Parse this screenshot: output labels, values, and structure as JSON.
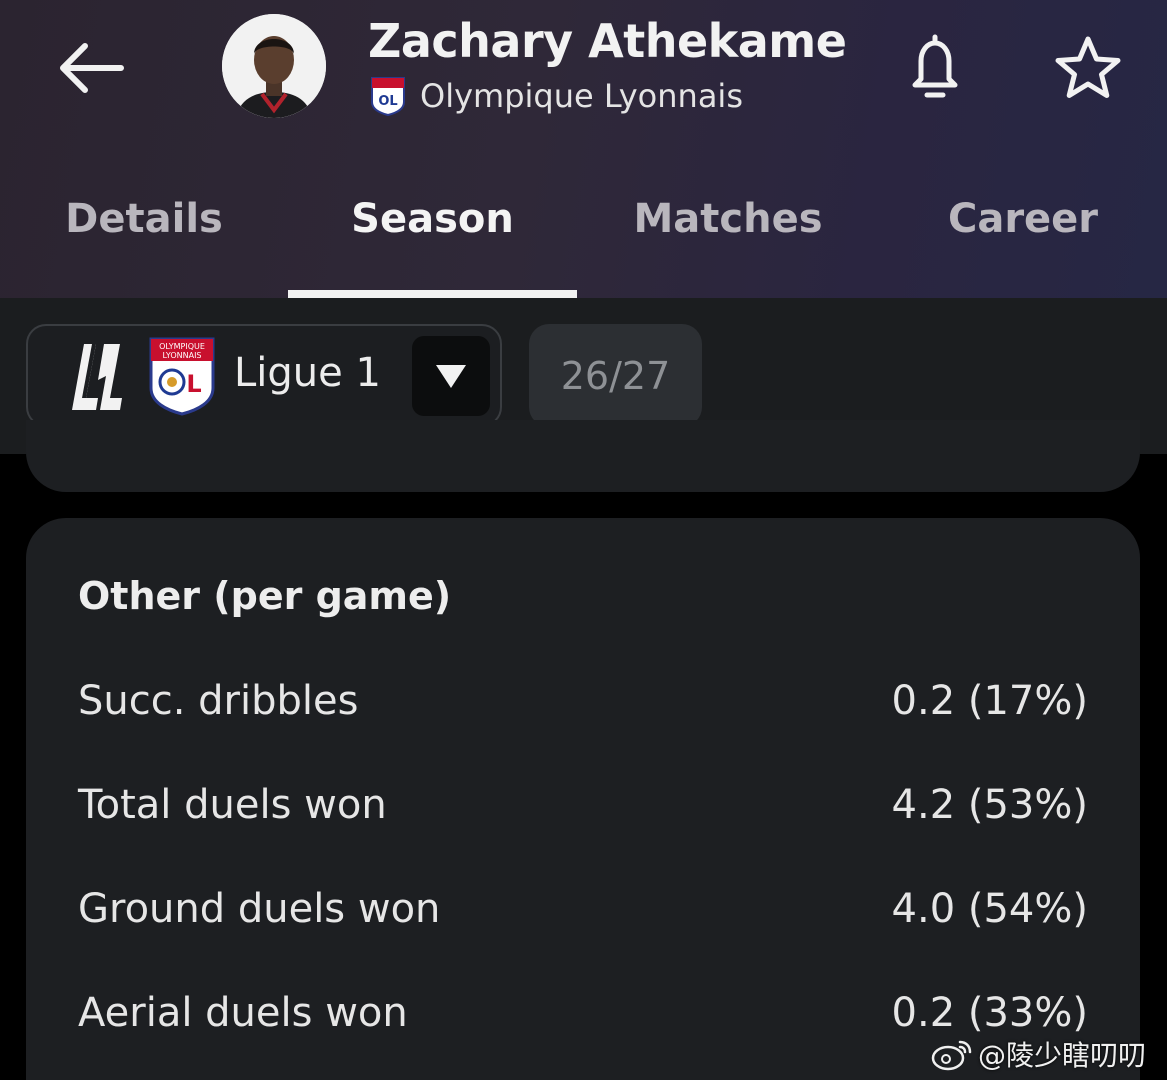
{
  "header": {
    "player_name": "Zachary Athekame",
    "club_name": "Olympique Lyonnais",
    "club_badge_text": "OLYMPIQUE LYONNAIS",
    "club_badge_mark": "OL"
  },
  "tabs": [
    {
      "label": "Details",
      "active": false
    },
    {
      "label": "Season",
      "active": true
    },
    {
      "label": "Matches",
      "active": false
    },
    {
      "label": "Career",
      "active": false
    }
  ],
  "filter": {
    "league_name": "Ligue 1",
    "season": "26/27"
  },
  "stats_card": {
    "title": "Other (per game)",
    "rows": [
      {
        "label": "Succ. dribbles",
        "value": "0.2 (17%)"
      },
      {
        "label": "Total duels won",
        "value": "4.2 (53%)"
      },
      {
        "label": "Ground duels won",
        "value": "4.0 (54%)"
      },
      {
        "label": "Aerial duels won",
        "value": "0.2 (33%)"
      }
    ]
  },
  "watermark": {
    "text": "@陵少瞎叨叨"
  },
  "icons": {
    "back": "back-arrow-icon",
    "notification": "bell-icon",
    "favorite": "star-icon",
    "dropdown": "triangle-down-icon"
  },
  "colors": {
    "header_bg": "#2d2737",
    "active_tab": "#f4f4f4",
    "inactive_tab": "#b9b6bd",
    "card_bg": "#1d1f22",
    "filter_bg": "#1b1d1f"
  }
}
